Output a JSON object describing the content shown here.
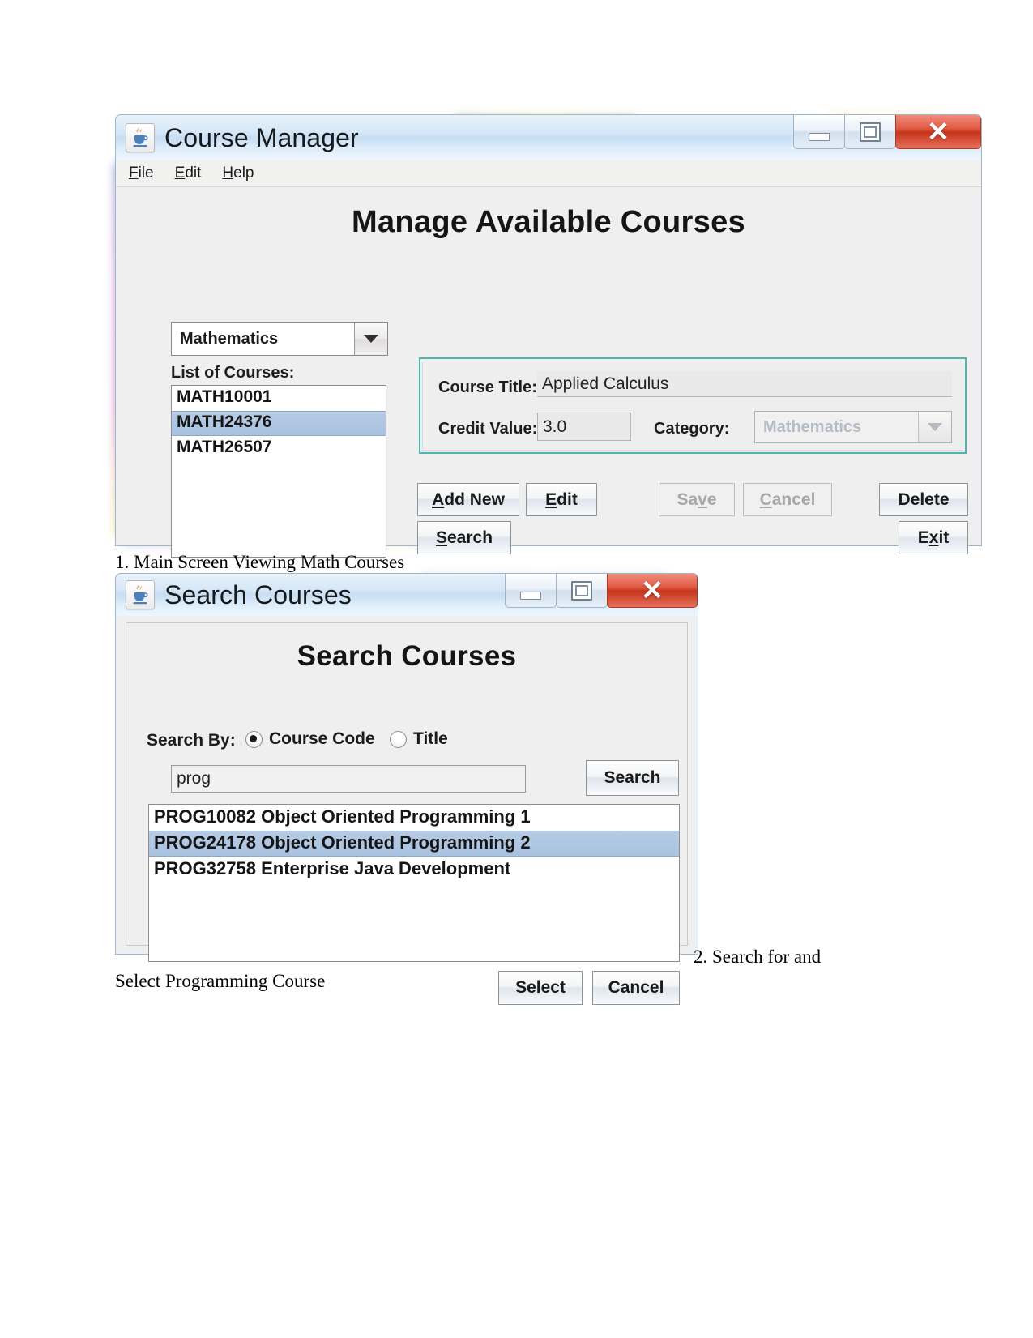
{
  "captions": [
    {
      "text": "1. Main Screen Viewing Math Courses"
    },
    {
      "text": "2. Search for and"
    },
    {
      "text": "Select Programming Course"
    }
  ],
  "window_main": {
    "title": "Course Manager",
    "icon": "java-coffee-cup-icon",
    "controls": {
      "minimize": "minimize-icon",
      "maximize": "maximize-icon",
      "close": "✕"
    },
    "menubar": [
      {
        "mnemonic": "F",
        "rest": "ile"
      },
      {
        "mnemonic": "E",
        "rest": "dit"
      },
      {
        "mnemonic": "H",
        "rest": "elp"
      }
    ],
    "heading": "Manage Available Courses",
    "category_combo": {
      "value": "Mathematics",
      "icon": "chevron-down-icon"
    },
    "list_label": "List of Courses:",
    "course_list": [
      {
        "code": "MATH10001",
        "selected": false
      },
      {
        "code": "MATH24376",
        "selected": true
      },
      {
        "code": "MATH26507",
        "selected": false
      }
    ],
    "details": {
      "title_label": "Course Title:",
      "title_value": "Applied Calculus",
      "credit_label": "Credit Value:",
      "credit_value": "3.0",
      "category_label": "Category:",
      "category_value": "Mathematics",
      "category_disabled": true
    },
    "buttons": {
      "add_new": {
        "pre": "A",
        "mnemonic": "",
        "label_before": "",
        "label": "Add New",
        "m_index": 0,
        "disabled": false
      },
      "edit": {
        "label": "Edit",
        "m_index": 0,
        "disabled": false
      },
      "search": {
        "label": "Search",
        "m_index": 0,
        "disabled": false
      },
      "save": {
        "label": "Save",
        "m_index": 2,
        "disabled": true
      },
      "cancel": {
        "label": "Cancel",
        "m_index": 0,
        "disabled": true
      },
      "delete": {
        "label": "Delete",
        "m_index": -1,
        "disabled": false
      },
      "exit": {
        "label": "Exit",
        "m_index": 1,
        "disabled": false
      }
    }
  },
  "window_search": {
    "title": "Search Courses",
    "icon": "java-coffee-cup-icon",
    "controls": {
      "minimize": "minimize-icon",
      "maximize": "maximize-icon",
      "close": "✕"
    },
    "heading": "Search Courses",
    "search_by_label": "Search By:",
    "radios": [
      {
        "label": "Course Code",
        "selected": true
      },
      {
        "label": "Title",
        "selected": false
      }
    ],
    "query_value": "prog",
    "search_button": "Search",
    "results": [
      {
        "text": "PROG10082 Object Oriented Programming 1",
        "selected": false
      },
      {
        "text": "PROG24178 Object Oriented Programming 2",
        "selected": true
      },
      {
        "text": "PROG32758 Enterprise Java Development",
        "selected": false
      }
    ],
    "select_button": "Select",
    "cancel_button": "Cancel"
  },
  "colors": {
    "accent_teal": "#4fb3ae",
    "selection_blue": "#a8c2e0",
    "close_red": "#c6341c"
  }
}
